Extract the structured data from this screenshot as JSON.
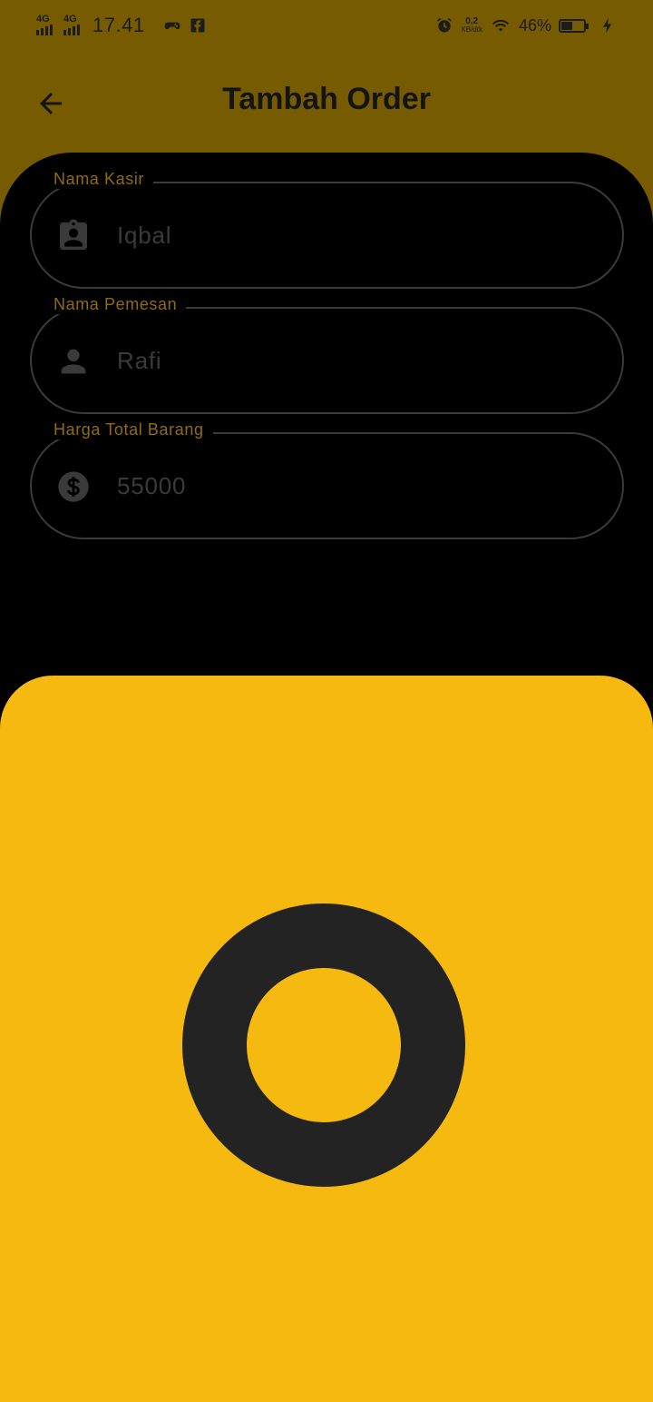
{
  "status_bar": {
    "network_1": "4G",
    "network_2": "4G",
    "time": "17.41",
    "speed_value": "0,2",
    "speed_unit": "KB/dtk",
    "battery_percent": "46%",
    "battery_level": 0.46,
    "icons": [
      "game-controller-icon",
      "facebook-icon",
      "alarm-icon",
      "wifi-icon",
      "battery-icon",
      "charging-icon"
    ]
  },
  "app_bar": {
    "title": "Tambah Order",
    "back_icon": "arrow-back-icon"
  },
  "form": {
    "fields": [
      {
        "label": "Nama Kasir",
        "value": "Iqbal",
        "icon": "contact-badge-icon"
      },
      {
        "label": "Nama Pemesan",
        "value": "Rafi",
        "icon": "person-icon"
      },
      {
        "label": "Harga Total Barang",
        "value": "55000",
        "icon": "dollar-circle-icon"
      }
    ]
  },
  "colors": {
    "header_bg": "#765b00",
    "panel_bg": "#000000",
    "sheet_bg": "#f6b90f",
    "spinner": "#232323",
    "label": "#8f6c0c"
  },
  "loading": {
    "spinner_icon": "loading-spinner-icon"
  }
}
